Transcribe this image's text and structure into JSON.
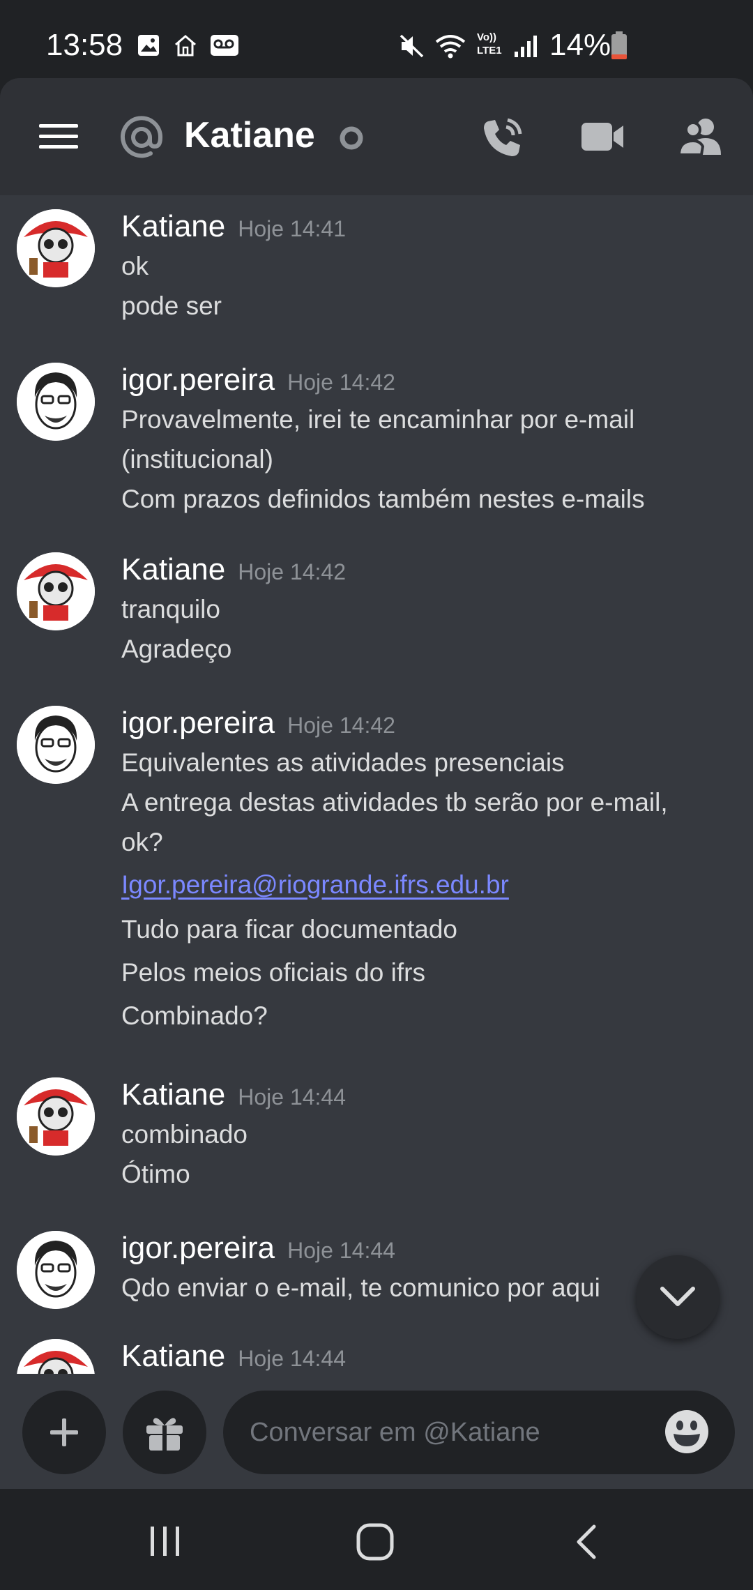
{
  "status_bar": {
    "time": "13:58",
    "battery": "14%",
    "left_icons": [
      "gallery-icon",
      "home-icon",
      "voicemail-icon"
    ],
    "right_icons": [
      "mute-icon",
      "wifi-icon",
      "volte-icon",
      "signal-icon",
      "battery-icon"
    ],
    "volte_label": "Vo)) LTE1"
  },
  "header": {
    "title": "Katiane",
    "status": "offline",
    "icons": [
      "menu-icon",
      "at-icon",
      "call-icon",
      "video-icon",
      "members-icon"
    ]
  },
  "messages": [
    {
      "author": "Katiane",
      "time": "Hoje 14:41",
      "lines": [
        "ok",
        "pode ser"
      ]
    },
    {
      "author": "igor.pereira",
      "time": "Hoje 14:42",
      "lines": [
        "Provavelmente, irei te encaminhar por e-mail",
        "(institucional)",
        "Com prazos definidos também nestes e-mails"
      ]
    },
    {
      "author": "Katiane",
      "time": "Hoje 14:42",
      "lines": [
        "tranquilo",
        "Agradeço"
      ]
    },
    {
      "author": "igor.pereira",
      "time": "Hoje 14:42",
      "lines": [
        "Equivalentes as atividades presenciais",
        "A entrega destas atividades tb serão por e-mail,",
        "ok?",
        "Igor.pereira@riogrande.ifrs.edu.br",
        "Tudo para ficar documentado",
        "Pelos meios oficiais do ifrs",
        "Combinado?"
      ]
    },
    {
      "author": "Katiane",
      "time": "Hoje 14:44",
      "lines": [
        "combinado",
        "Ótimo"
      ]
    },
    {
      "author": "igor.pereira",
      "time": "Hoje 14:44",
      "lines": [
        "Qdo enviar o e-mail, te comunico por aqui"
      ]
    },
    {
      "author": "Katiane",
      "time": "Hoje 14:44",
      "lines": []
    }
  ],
  "input": {
    "placeholder": "Conversar em @Katiane"
  },
  "colors": {
    "background": "#36393f",
    "header": "#2f3136",
    "dark": "#202225",
    "link": "#7b88ff",
    "timestamp": "#8e9297",
    "avatar_red": "#d72b2b"
  }
}
